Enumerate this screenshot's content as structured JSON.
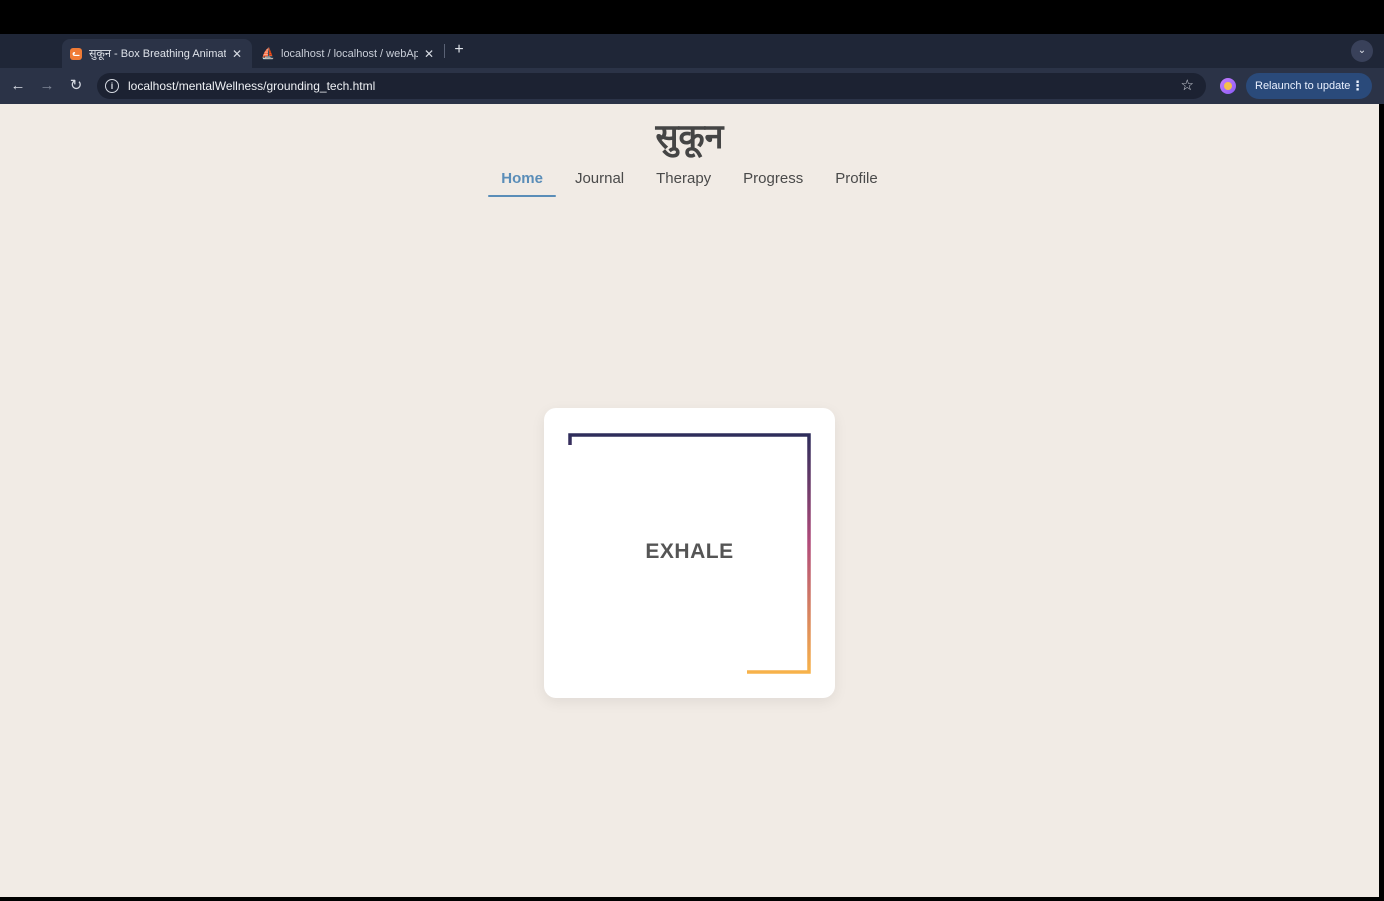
{
  "browser": {
    "tabs": [
      {
        "title": "सुकून - Box Breathing Animatio",
        "favicon": "app-favicon",
        "active": true
      },
      {
        "title": "localhost / localhost / webApp",
        "favicon": "phpmyadmin-favicon",
        "active": false
      }
    ],
    "url": "localhost/mentalWellness/grounding_tech.html",
    "relaunch_label": "Relaunch to update"
  },
  "site": {
    "logo": "सुकून",
    "nav": [
      "Home",
      "Journal",
      "Therapy",
      "Progress",
      "Profile"
    ],
    "active_nav": "Home"
  },
  "breathing": {
    "phase": "EXHALE",
    "colors": {
      "start": "#2e2d5b",
      "mid": "#b04a7a",
      "end": "#f7b24a"
    }
  },
  "colors": {
    "page_bg": "#f1ebe5",
    "accent": "#5a8db8"
  }
}
